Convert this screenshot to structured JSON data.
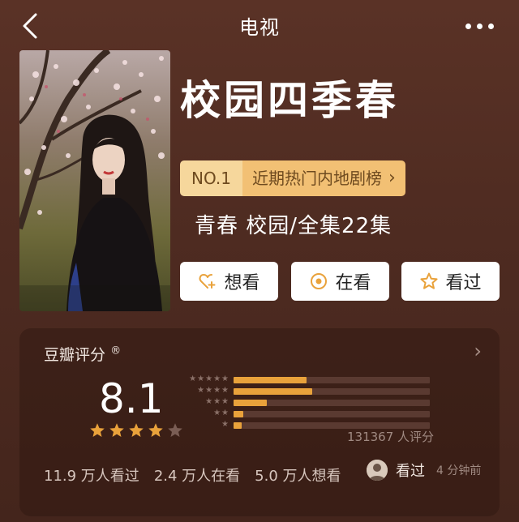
{
  "nav": {
    "title": "电视"
  },
  "show": {
    "title": "校园四季春",
    "rank_no": "NO.1",
    "rank_text": "近期热门内地剧榜",
    "genre": "青春 校园/全集22集"
  },
  "actions": {
    "want": "想看",
    "watching": "在看",
    "watched": "看过"
  },
  "rating": {
    "source": "豆瓣评分",
    "source_mark": "®",
    "score": "8.1",
    "stars": 4,
    "count": "131367 人评分",
    "distribution": [
      {
        "stars": 5,
        "percent": 0.37
      },
      {
        "stars": 4,
        "percent": 0.4
      },
      {
        "stars": 3,
        "percent": 0.17
      },
      {
        "stars": 2,
        "percent": 0.05
      },
      {
        "stars": 1,
        "percent": 0.04
      }
    ],
    "stats": {
      "watched": "11.9 万人看过",
      "watching": "2.4 万人在看",
      "want": "5.0 万人想看"
    },
    "recent": {
      "label": "看过",
      "time": "4 分钟前"
    }
  },
  "colors": {
    "accent": "#e9a23b",
    "badge_light": "#f6d79c",
    "badge_dark": "#f2c074",
    "background": "#4e2b21"
  },
  "icons": [
    "back-icon",
    "more-icon",
    "heart-plus-icon",
    "target-icon",
    "star-icon",
    "chevron-right-icon"
  ]
}
